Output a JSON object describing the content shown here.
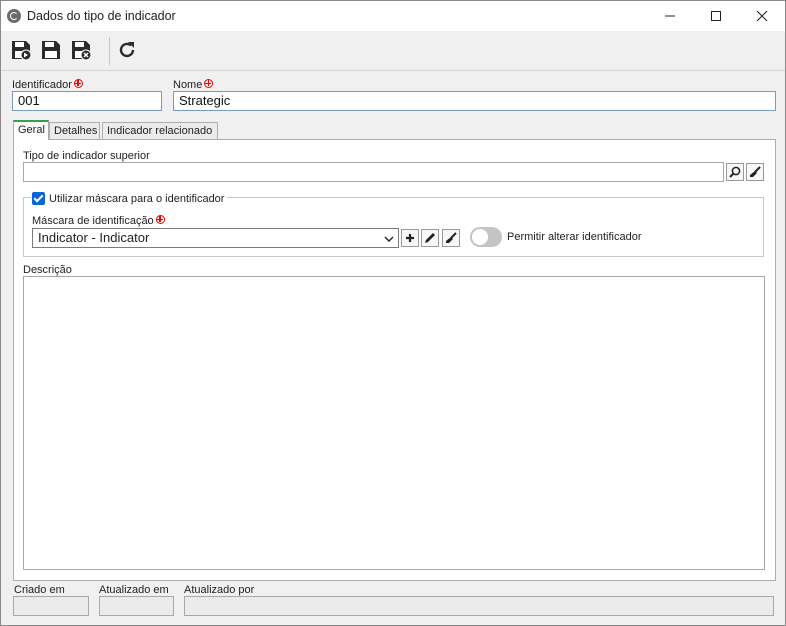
{
  "window": {
    "title": "Dados do tipo de indicador"
  },
  "toolbar": {
    "icons": [
      "save-new-icon",
      "save-icon",
      "save-close-icon",
      "refresh-icon"
    ]
  },
  "form": {
    "identifier_label": "Identificador",
    "identifier_value": "001",
    "name_label": "Nome",
    "name_value": "Strategic"
  },
  "tabs": [
    {
      "label": "Geral",
      "active": true
    },
    {
      "label": "Detalhes",
      "active": false
    },
    {
      "label": "Indicador relacionado",
      "active": false
    }
  ],
  "general": {
    "parent_type_label": "Tipo de indicador superior",
    "parent_type_value": "",
    "use_mask_label": "Utilizar máscara para o identificador",
    "use_mask_checked": true,
    "mask_label": "Máscara de identificação",
    "mask_value": "Indicator - Indicator",
    "allow_change_label": "Permitir alterar identificador",
    "allow_change_on": false,
    "description_label": "Descrição",
    "description_value": ""
  },
  "footer": {
    "created_label": "Criado em",
    "updated_label": "Atualizado em",
    "updated_by_label": "Atualizado por"
  },
  "colors": {
    "accent_tab": "#3aa04a",
    "required": "#e00000",
    "checkbox": "#0a66d6"
  }
}
